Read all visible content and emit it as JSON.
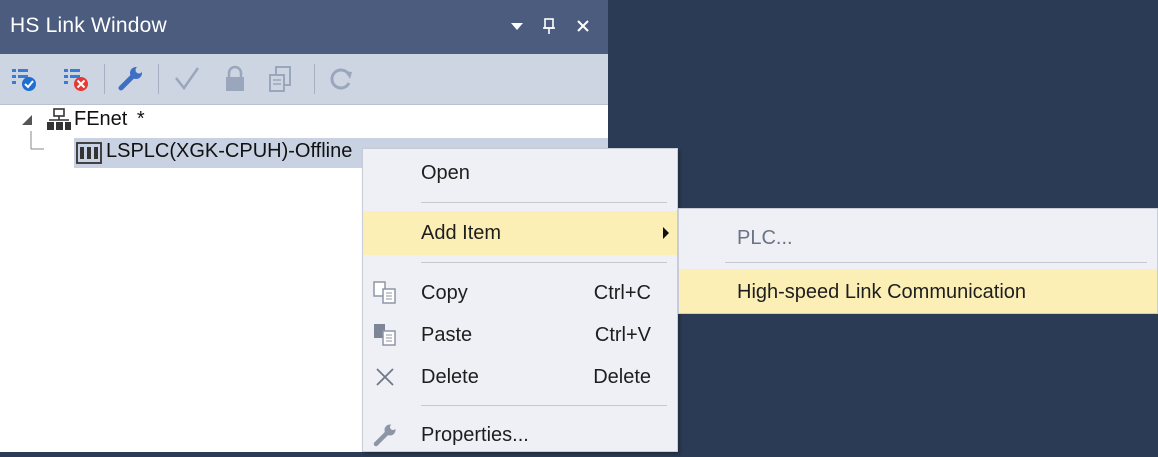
{
  "window": {
    "title": "HS Link Window",
    "pin_glyph": "ᚕ",
    "close_glyph": "×",
    "dropdown_glyph": "▾"
  },
  "toolbar": {
    "icons": [
      "connect-icon",
      "disconnect-icon",
      "wrench-icon",
      "check-icon",
      "lock-icon",
      "export-icon",
      "refresh-icon"
    ]
  },
  "tree": {
    "root_label": "FEnet",
    "root_suffix": "*",
    "child_label": "LSPLC(XGK-CPUH)-Offline"
  },
  "context_menu": {
    "open": "Open",
    "add_item": "Add Item",
    "copy": "Copy",
    "copy_shortcut": "Ctrl+C",
    "paste": "Paste",
    "paste_shortcut": "Ctrl+V",
    "delete": "Delete",
    "delete_shortcut": "Delete",
    "properties": "Properties..."
  },
  "submenu": {
    "plc": "PLC...",
    "hs_link": "High-speed Link Communication"
  },
  "colors": {
    "titlebar": "#4b5c7e",
    "toolbar": "#cdd5e3",
    "highlight": "#fcefb6",
    "background": "#2b3a55"
  }
}
